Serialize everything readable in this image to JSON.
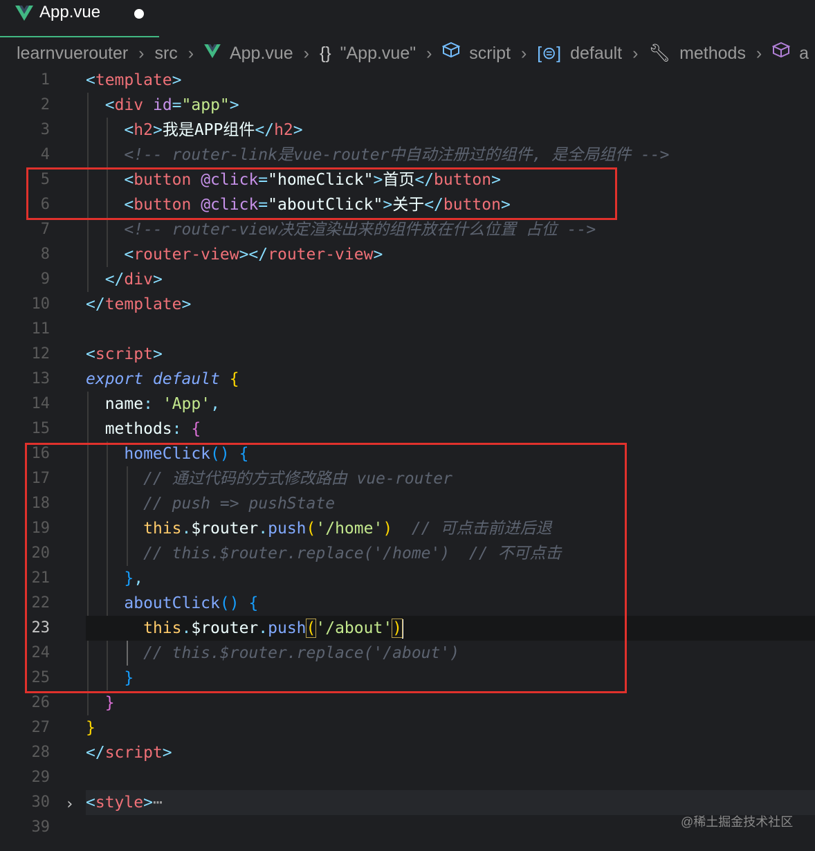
{
  "tab": {
    "filename": "App.vue"
  },
  "breadcrumb": {
    "items": [
      "learnvuerouter",
      "src",
      "App.vue",
      "\"App.vue\"",
      "script",
      "default",
      "methods",
      "a"
    ]
  },
  "editor": {
    "line_numbers": [
      "1",
      "2",
      "3",
      "4",
      "5",
      "6",
      "7",
      "8",
      "9",
      "10",
      "11",
      "12",
      "13",
      "14",
      "15",
      "16",
      "17",
      "18",
      "19",
      "20",
      "21",
      "22",
      "23",
      "24",
      "25",
      "26",
      "27",
      "28",
      "29",
      "30",
      "39"
    ],
    "active_line": "23",
    "lines": {
      "l3_text": "我是APP组件",
      "l4_comment": "<!-- router-link是vue-router中自动注册过的组件, 是全局组件 -->",
      "l5_handler": "\"homeClick\"",
      "l5_text": "首页",
      "l6_handler": "\"aboutClick\"",
      "l6_text": "关于",
      "l7_comment": "<!-- router-view决定渲染出来的组件放在什么位置 占位 -->",
      "l14_name": "'App'",
      "l17_comment": "// 通过代码的方式修改路由 vue-router",
      "l18_comment": "// push => pushState",
      "l19_arg": "'/home'",
      "l19_comment": "// 可点击前进后退",
      "l20_comment": "// this.$router.replace('/home')  // 不可点击",
      "l23_arg": "'/about'",
      "l24_comment": "// this.$router.replace('/about')"
    }
  },
  "watermark": "@稀土掘金技术社区"
}
